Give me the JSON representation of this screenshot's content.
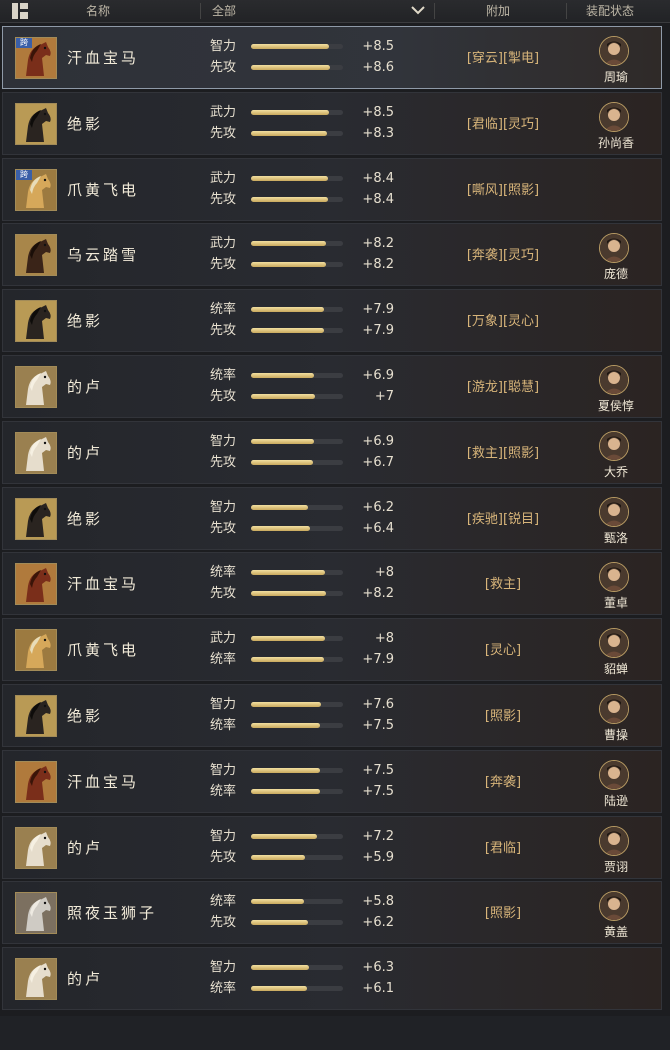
{
  "header": {
    "name_label": "名称",
    "filter_label": "全部",
    "extra_label": "附加",
    "equip_label": "装配状态"
  },
  "cross_badge": "跨",
  "colors": {
    "accent_gold": "#d8b57a",
    "bar_fill": "#e6cd8a",
    "cross_badge": "#3a5fa8"
  },
  "rows": [
    {
      "name": "汗血宝马",
      "horse": "red",
      "cross": true,
      "selected": true,
      "stat1": {
        "label": "智力",
        "value": "+8.5"
      },
      "stat2": {
        "label": "先攻",
        "value": "+8.6"
      },
      "extra": "[穿云][掣电]",
      "hero": "周瑜"
    },
    {
      "name": "绝影",
      "horse": "black",
      "cross": false,
      "stat1": {
        "label": "武力",
        "value": "+8.5"
      },
      "stat2": {
        "label": "先攻",
        "value": "+8.3"
      },
      "extra": "[君临][灵巧]",
      "hero": "孙尚香"
    },
    {
      "name": "爪黄飞电",
      "horse": "yellow",
      "cross": true,
      "stat1": {
        "label": "武力",
        "value": "+8.4"
      },
      "stat2": {
        "label": "先攻",
        "value": "+8.4"
      },
      "extra": "[嘶风][照影]",
      "hero": ""
    },
    {
      "name": "乌云踏雪",
      "horse": "dark",
      "cross": false,
      "stat1": {
        "label": "武力",
        "value": "+8.2"
      },
      "stat2": {
        "label": "先攻",
        "value": "+8.2"
      },
      "extra": "[奔袭][灵巧]",
      "hero": "庞德"
    },
    {
      "name": "绝影",
      "horse": "black",
      "cross": false,
      "stat1": {
        "label": "统率",
        "value": "+7.9"
      },
      "stat2": {
        "label": "先攻",
        "value": "+7.9"
      },
      "extra": "[万象][灵心]",
      "hero": ""
    },
    {
      "name": "的卢",
      "horse": "white",
      "cross": false,
      "stat1": {
        "label": "统率",
        "value": "+6.9"
      },
      "stat2": {
        "label": "先攻",
        "value": "+7"
      },
      "extra": "[游龙][聪慧]",
      "hero": "夏侯惇"
    },
    {
      "name": "的卢",
      "horse": "white",
      "cross": false,
      "stat1": {
        "label": "智力",
        "value": "+6.9"
      },
      "stat2": {
        "label": "先攻",
        "value": "+6.7"
      },
      "extra": "[救主][照影]",
      "hero": "大乔"
    },
    {
      "name": "绝影",
      "horse": "black",
      "cross": false,
      "stat1": {
        "label": "智力",
        "value": "+6.2"
      },
      "stat2": {
        "label": "先攻",
        "value": "+6.4"
      },
      "extra": "[疾驰][锐目]",
      "hero": "甄洛"
    },
    {
      "name": "汗血宝马",
      "horse": "red",
      "cross": false,
      "stat1": {
        "label": "统率",
        "value": "+8"
      },
      "stat2": {
        "label": "先攻",
        "value": "+8.2"
      },
      "extra": "[救主]",
      "hero": "董卓"
    },
    {
      "name": "爪黄飞电",
      "horse": "yellow",
      "cross": false,
      "stat1": {
        "label": "武力",
        "value": "+8"
      },
      "stat2": {
        "label": "统率",
        "value": "+7.9"
      },
      "extra": "[灵心]",
      "hero": "貂蝉"
    },
    {
      "name": "绝影",
      "horse": "black",
      "cross": false,
      "stat1": {
        "label": "智力",
        "value": "+7.6"
      },
      "stat2": {
        "label": "统率",
        "value": "+7.5"
      },
      "extra": "[照影]",
      "hero": "曹操"
    },
    {
      "name": "汗血宝马",
      "horse": "red",
      "cross": false,
      "stat1": {
        "label": "智力",
        "value": "+7.5"
      },
      "stat2": {
        "label": "统率",
        "value": "+7.5"
      },
      "extra": "[奔袭]",
      "hero": "陆逊"
    },
    {
      "name": "的卢",
      "horse": "white",
      "cross": false,
      "stat1": {
        "label": "智力",
        "value": "+7.2"
      },
      "stat2": {
        "label": "先攻",
        "value": "+5.9"
      },
      "extra": "[君临]",
      "hero": "贾诩"
    },
    {
      "name": "照夜玉狮子",
      "horse": "silver",
      "cross": false,
      "stat1": {
        "label": "统率",
        "value": "+5.8"
      },
      "stat2": {
        "label": "先攻",
        "value": "+6.2"
      },
      "extra": "[照影]",
      "hero": "黄盖"
    },
    {
      "name": "的卢",
      "horse": "white",
      "cross": false,
      "stat1": {
        "label": "智力",
        "value": "+6.3"
      },
      "stat2": {
        "label": "统率",
        "value": "+6.1"
      },
      "extra": "",
      "hero": ""
    }
  ]
}
